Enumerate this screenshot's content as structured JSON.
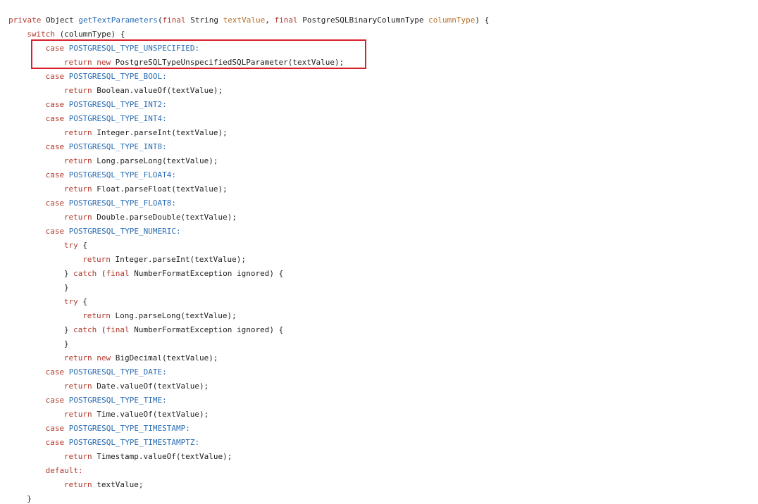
{
  "colors": {
    "background": "#ffffff",
    "keyword": "#b0392c",
    "constant": "#2a6cb3",
    "method_name": "#2a6cb3",
    "parameter": "#b8702a",
    "plain": "#222222",
    "highlight_border": "#d8202b"
  },
  "code": {
    "lines": [
      {
        "indent": 0,
        "tokens": [
          {
            "t": "kw",
            "v": "private"
          },
          {
            "t": "plain",
            "v": " Object "
          },
          {
            "t": "fn",
            "v": "getTextParameters"
          },
          {
            "t": "plain",
            "v": "("
          },
          {
            "t": "kw",
            "v": "final"
          },
          {
            "t": "plain",
            "v": " String "
          },
          {
            "t": "param",
            "v": "textValue"
          },
          {
            "t": "plain",
            "v": ", "
          },
          {
            "t": "kw",
            "v": "final"
          },
          {
            "t": "plain",
            "v": " PostgreSQLBinaryColumnType "
          },
          {
            "t": "param",
            "v": "columnType"
          },
          {
            "t": "plain",
            "v": ") {"
          }
        ]
      },
      {
        "indent": 1,
        "tokens": [
          {
            "t": "kw",
            "v": "switch"
          },
          {
            "t": "plain",
            "v": " (columnType) {"
          }
        ]
      },
      {
        "indent": 2,
        "tokens": [
          {
            "t": "kw",
            "v": "case"
          },
          {
            "t": "plain",
            "v": " "
          },
          {
            "t": "const",
            "v": "POSTGRESQL_TYPE_UNSPECIFIED:"
          }
        ]
      },
      {
        "indent": 3,
        "tokens": [
          {
            "t": "kw",
            "v": "return"
          },
          {
            "t": "plain",
            "v": " "
          },
          {
            "t": "kw",
            "v": "new"
          },
          {
            "t": "plain",
            "v": " PostgreSQLTypeUnspecifiedSQLParameter(textValue);"
          }
        ]
      },
      {
        "indent": 2,
        "tokens": [
          {
            "t": "kw",
            "v": "case"
          },
          {
            "t": "plain",
            "v": " "
          },
          {
            "t": "const",
            "v": "POSTGRESQL_TYPE_BOOL:"
          }
        ]
      },
      {
        "indent": 3,
        "tokens": [
          {
            "t": "kw",
            "v": "return"
          },
          {
            "t": "plain",
            "v": " Boolean.valueOf(textValue);"
          }
        ]
      },
      {
        "indent": 2,
        "tokens": [
          {
            "t": "kw",
            "v": "case"
          },
          {
            "t": "plain",
            "v": " "
          },
          {
            "t": "const",
            "v": "POSTGRESQL_TYPE_INT2:"
          }
        ]
      },
      {
        "indent": 2,
        "tokens": [
          {
            "t": "kw",
            "v": "case"
          },
          {
            "t": "plain",
            "v": " "
          },
          {
            "t": "const",
            "v": "POSTGRESQL_TYPE_INT4:"
          }
        ]
      },
      {
        "indent": 3,
        "tokens": [
          {
            "t": "kw",
            "v": "return"
          },
          {
            "t": "plain",
            "v": " Integer.parseInt(textValue);"
          }
        ]
      },
      {
        "indent": 2,
        "tokens": [
          {
            "t": "kw",
            "v": "case"
          },
          {
            "t": "plain",
            "v": " "
          },
          {
            "t": "const",
            "v": "POSTGRESQL_TYPE_INT8:"
          }
        ]
      },
      {
        "indent": 3,
        "tokens": [
          {
            "t": "kw",
            "v": "return"
          },
          {
            "t": "plain",
            "v": " Long.parseLong(textValue);"
          }
        ]
      },
      {
        "indent": 2,
        "tokens": [
          {
            "t": "kw",
            "v": "case"
          },
          {
            "t": "plain",
            "v": " "
          },
          {
            "t": "const",
            "v": "POSTGRESQL_TYPE_FLOAT4:"
          }
        ]
      },
      {
        "indent": 3,
        "tokens": [
          {
            "t": "kw",
            "v": "return"
          },
          {
            "t": "plain",
            "v": " Float.parseFloat(textValue);"
          }
        ]
      },
      {
        "indent": 2,
        "tokens": [
          {
            "t": "kw",
            "v": "case"
          },
          {
            "t": "plain",
            "v": " "
          },
          {
            "t": "const",
            "v": "POSTGRESQL_TYPE_FLOAT8:"
          }
        ]
      },
      {
        "indent": 3,
        "tokens": [
          {
            "t": "kw",
            "v": "return"
          },
          {
            "t": "plain",
            "v": " Double.parseDouble(textValue);"
          }
        ]
      },
      {
        "indent": 2,
        "tokens": [
          {
            "t": "kw",
            "v": "case"
          },
          {
            "t": "plain",
            "v": " "
          },
          {
            "t": "const",
            "v": "POSTGRESQL_TYPE_NUMERIC:"
          }
        ]
      },
      {
        "indent": 3,
        "tokens": [
          {
            "t": "kw",
            "v": "try"
          },
          {
            "t": "plain",
            "v": " {"
          }
        ]
      },
      {
        "indent": 4,
        "tokens": [
          {
            "t": "kw",
            "v": "return"
          },
          {
            "t": "plain",
            "v": " Integer.parseInt(textValue);"
          }
        ]
      },
      {
        "indent": 3,
        "tokens": [
          {
            "t": "plain",
            "v": "} "
          },
          {
            "t": "kw",
            "v": "catch"
          },
          {
            "t": "plain",
            "v": " ("
          },
          {
            "t": "kw",
            "v": "final"
          },
          {
            "t": "plain",
            "v": " NumberFormatException ignored) {"
          }
        ]
      },
      {
        "indent": 3,
        "tokens": [
          {
            "t": "plain",
            "v": "}"
          }
        ]
      },
      {
        "indent": 3,
        "tokens": [
          {
            "t": "kw",
            "v": "try"
          },
          {
            "t": "plain",
            "v": " {"
          }
        ]
      },
      {
        "indent": 4,
        "tokens": [
          {
            "t": "kw",
            "v": "return"
          },
          {
            "t": "plain",
            "v": " Long.parseLong(textValue);"
          }
        ]
      },
      {
        "indent": 3,
        "tokens": [
          {
            "t": "plain",
            "v": "} "
          },
          {
            "t": "kw",
            "v": "catch"
          },
          {
            "t": "plain",
            "v": " ("
          },
          {
            "t": "kw",
            "v": "final"
          },
          {
            "t": "plain",
            "v": " NumberFormatException ignored) {"
          }
        ]
      },
      {
        "indent": 3,
        "tokens": [
          {
            "t": "plain",
            "v": "}"
          }
        ]
      },
      {
        "indent": 3,
        "tokens": [
          {
            "t": "kw",
            "v": "return"
          },
          {
            "t": "plain",
            "v": " "
          },
          {
            "t": "kw",
            "v": "new"
          },
          {
            "t": "plain",
            "v": " BigDecimal(textValue);"
          }
        ]
      },
      {
        "indent": 2,
        "tokens": [
          {
            "t": "kw",
            "v": "case"
          },
          {
            "t": "plain",
            "v": " "
          },
          {
            "t": "const",
            "v": "POSTGRESQL_TYPE_DATE:"
          }
        ]
      },
      {
        "indent": 3,
        "tokens": [
          {
            "t": "kw",
            "v": "return"
          },
          {
            "t": "plain",
            "v": " Date.valueOf(textValue);"
          }
        ]
      },
      {
        "indent": 2,
        "tokens": [
          {
            "t": "kw",
            "v": "case"
          },
          {
            "t": "plain",
            "v": " "
          },
          {
            "t": "const",
            "v": "POSTGRESQL_TYPE_TIME:"
          }
        ]
      },
      {
        "indent": 3,
        "tokens": [
          {
            "t": "kw",
            "v": "return"
          },
          {
            "t": "plain",
            "v": " Time.valueOf(textValue);"
          }
        ]
      },
      {
        "indent": 2,
        "tokens": [
          {
            "t": "kw",
            "v": "case"
          },
          {
            "t": "plain",
            "v": " "
          },
          {
            "t": "const",
            "v": "POSTGRESQL_TYPE_TIMESTAMP:"
          }
        ]
      },
      {
        "indent": 2,
        "tokens": [
          {
            "t": "kw",
            "v": "case"
          },
          {
            "t": "plain",
            "v": " "
          },
          {
            "t": "const",
            "v": "POSTGRESQL_TYPE_TIMESTAMPTZ:"
          }
        ]
      },
      {
        "indent": 3,
        "tokens": [
          {
            "t": "kw",
            "v": "return"
          },
          {
            "t": "plain",
            "v": " Timestamp.valueOf(textValue);"
          }
        ]
      },
      {
        "indent": 2,
        "tokens": [
          {
            "t": "kw",
            "v": "default:"
          }
        ]
      },
      {
        "indent": 3,
        "tokens": [
          {
            "t": "kw",
            "v": "return"
          },
          {
            "t": "plain",
            "v": " textValue;"
          }
        ]
      },
      {
        "indent": 1,
        "tokens": [
          {
            "t": "plain",
            "v": "}"
          }
        ]
      }
    ]
  }
}
